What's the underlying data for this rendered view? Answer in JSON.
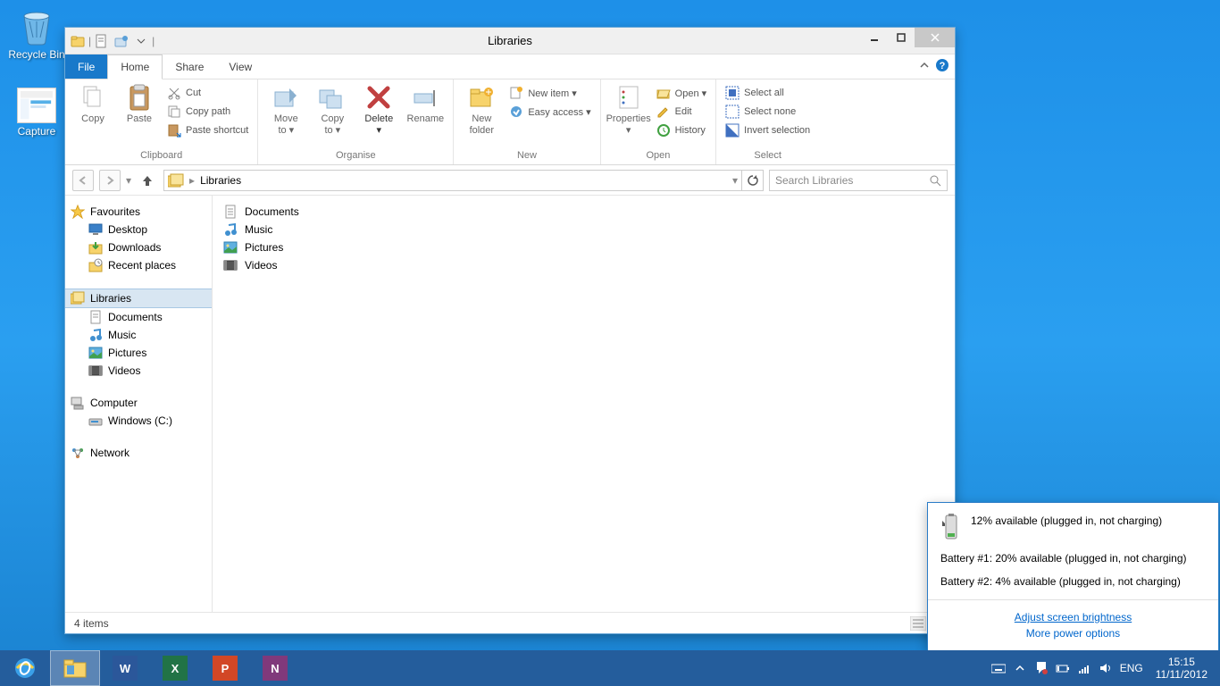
{
  "desktop": {
    "recycle_bin": "Recycle Bin",
    "capture": "Capture"
  },
  "window": {
    "title": "Libraries",
    "tabs": {
      "file": "File",
      "home": "Home",
      "share": "Share",
      "view": "View"
    },
    "ribbon": {
      "copy": "Copy",
      "paste": "Paste",
      "cut": "Cut",
      "copy_path": "Copy path",
      "paste_shortcut": "Paste shortcut",
      "clipboard": "Clipboard",
      "move_to": "Move\nto ▾",
      "copy_to": "Copy\nto ▾",
      "delete": "Delete\n▾",
      "rename": "Rename",
      "organise": "Organise",
      "new_folder": "New\nfolder",
      "new_item": "New item ▾",
      "easy_access": "Easy access ▾",
      "new": "New",
      "properties": "Properties\n▾",
      "open": "Open ▾",
      "edit": "Edit",
      "history": "History",
      "open_grp": "Open",
      "select_all": "Select all",
      "select_none": "Select none",
      "invert_selection": "Invert selection",
      "select": "Select"
    },
    "path": "Libraries",
    "search_placeholder": "Search Libraries",
    "sidebar": {
      "favourites": "Favourites",
      "desktop": "Desktop",
      "downloads": "Downloads",
      "recent": "Recent places",
      "libraries": "Libraries",
      "documents": "Documents",
      "music": "Music",
      "pictures": "Pictures",
      "videos": "Videos",
      "computer": "Computer",
      "windows_c": "Windows (C:)",
      "network": "Network"
    },
    "content": {
      "documents": "Documents",
      "music": "Music",
      "pictures": "Pictures",
      "videos": "Videos"
    },
    "status": "4 items"
  },
  "battery": {
    "summary": "12% available (plugged in, not charging)",
    "b1": "Battery #1: 20% available (plugged in, not charging)",
    "b2": "Battery #2: 4% available (plugged in, not charging)",
    "brightness": "Adjust screen brightness",
    "more": "More power options"
  },
  "tray": {
    "lang": "ENG",
    "time": "15:15",
    "date": "11/11/2012"
  }
}
